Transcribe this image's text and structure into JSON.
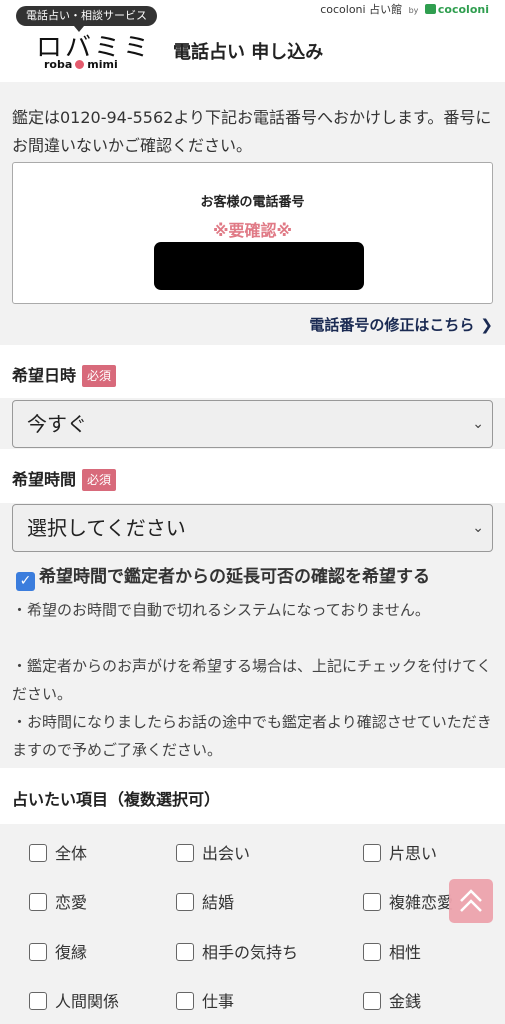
{
  "header": {
    "service_badge": "電話占い・相談サービス",
    "logo_main": "ロバミミ",
    "logo_sub_left": "roba",
    "logo_sub_right": "mimi",
    "page_title": "電話占い 申し込み",
    "brand_left": "cocoloni",
    "brand_mid": "占い館",
    "brand_by": "by",
    "brand_right": "cocoloni"
  },
  "notice": {
    "text": "鑑定は0120-94-5562より下記お電話番号へおかけします。番号にお間違いないかご確認ください。",
    "phone_label": "お客様の電話番号",
    "phone_warning": "※要確認※",
    "edit_link": "電話番号の修正はこちら"
  },
  "form": {
    "date": {
      "label": "希望日時",
      "required": "必須",
      "value": "今すぐ"
    },
    "time": {
      "label": "希望時間",
      "required": "必須",
      "value": "選択してください"
    },
    "extension_checkbox": {
      "label": "希望時間で鑑定者からの延長可否の確認を希望する",
      "checked": true
    },
    "notes": [
      "・希望のお時間で自動で切れるシステムになっておりません。",
      "・鑑定者からのお声がけを希望する場合は、上記にチェックを付けてください。",
      "・お時間になりましたらお話の途中でも鑑定者より確認させていただきますので予めご了承ください。"
    ],
    "topics_title": "占いたい項目（複数選択可）",
    "topics": [
      "全体",
      "出会い",
      "片思い",
      "恋愛",
      "結婚",
      "複雑恋愛",
      "復縁",
      "相手の気持ち",
      "相性",
      "人間関係",
      "仕事",
      "金銭"
    ]
  },
  "icons": {
    "dropdown": "chevron-down-icon",
    "edit": "chevron-right-icon",
    "scroll_top": "double-chevron-up-icon"
  },
  "colors": {
    "required_badge": "#d86a7b",
    "warning_text": "#e07a86",
    "checkbox_checked": "#3b7ddd",
    "scroll_top": "#eda3ad"
  }
}
